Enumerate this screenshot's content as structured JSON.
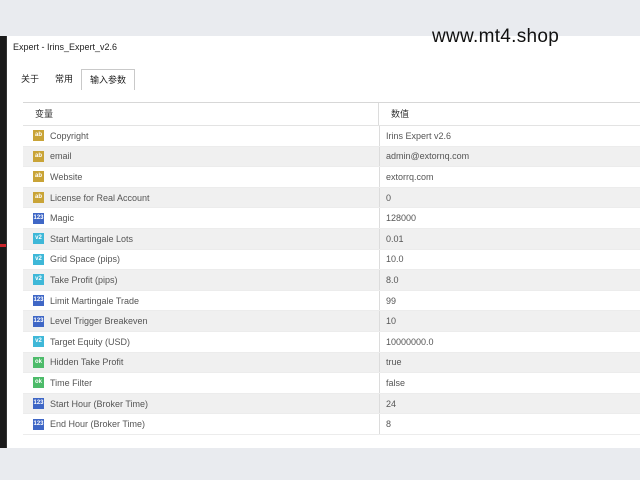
{
  "window": {
    "title": "Expert - Irins_Expert_v2.6"
  },
  "watermark": "www.mt4.shop",
  "tabs": [
    {
      "label": "关于",
      "active": false
    },
    {
      "label": "常用",
      "active": false
    },
    {
      "label": "输入参数",
      "active": true
    }
  ],
  "columns": {
    "variable": "变量",
    "value": "数值"
  },
  "params": [
    {
      "type": "string",
      "icon": "ab",
      "name": "Copyright",
      "value": "Irins Expert v2.6"
    },
    {
      "type": "string",
      "icon": "ab",
      "name": "email",
      "value": "admin@extornq.com"
    },
    {
      "type": "string",
      "icon": "ab",
      "name": "Website",
      "value": "extorrq.com"
    },
    {
      "type": "string",
      "icon": "ab",
      "name": "License for Real Account",
      "value": "0"
    },
    {
      "type": "int",
      "icon": "123",
      "name": "Magic",
      "value": "128000"
    },
    {
      "type": "double",
      "icon": "v2",
      "name": "Start Martingale Lots",
      "value": "0.01"
    },
    {
      "type": "double",
      "icon": "v2",
      "name": "Grid Space (pips)",
      "value": "10.0"
    },
    {
      "type": "double",
      "icon": "v2",
      "name": "Take Profit (pips)",
      "value": "8.0"
    },
    {
      "type": "int",
      "icon": "123",
      "name": "Limit Martingale Trade",
      "value": "99"
    },
    {
      "type": "int",
      "icon": "123",
      "name": "Level Trigger Breakeven",
      "value": "10"
    },
    {
      "type": "double",
      "icon": "v2",
      "name": "Target Equity (USD)",
      "value": "10000000.0"
    },
    {
      "type": "bool",
      "icon": "ok",
      "name": "Hidden Take Profit",
      "value": "true"
    },
    {
      "type": "bool",
      "icon": "ok",
      "name": "Time Filter",
      "value": "false"
    },
    {
      "type": "int",
      "icon": "123",
      "name": "Start Hour (Broker Time)",
      "value": "24"
    },
    {
      "type": "int",
      "icon": "123",
      "name": "End Hour (Broker Time)",
      "value": "8"
    }
  ],
  "colors": {
    "string": "#c9a437",
    "int": "#3f67c6",
    "double": "#3fb8d8",
    "bool": "#4dbb6a",
    "accent_red": "#c8242a"
  }
}
